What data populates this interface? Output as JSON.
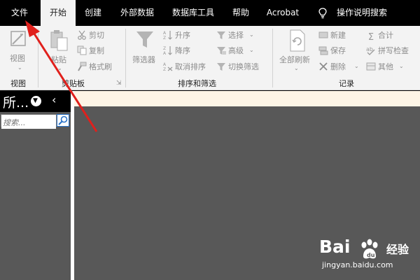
{
  "tabs": [
    {
      "label": "文件"
    },
    {
      "label": "开始"
    },
    {
      "label": "创建"
    },
    {
      "label": "外部数据"
    },
    {
      "label": "数据库工具"
    },
    {
      "label": "帮助"
    },
    {
      "label": "Acrobat"
    },
    {
      "label": "操作说明搜索"
    }
  ],
  "ribbon": {
    "views": {
      "button": "视图",
      "group": "视图"
    },
    "clipboard": {
      "paste": "粘贴",
      "cut": "剪切",
      "copy": "复制",
      "format_painter": "格式刷",
      "group": "剪贴板"
    },
    "sort_filter": {
      "filter": "筛选器",
      "ascending": "升序",
      "descending": "降序",
      "remove_sort": "取消排序",
      "selection": "选择",
      "advanced": "高级",
      "toggle_filter": "切换筛选",
      "group": "排序和筛选"
    },
    "records": {
      "refresh_all": "全部刷新",
      "new": "新建",
      "save": "保存",
      "delete": "删除",
      "totals": "合计",
      "spelling": "拼写检查",
      "more": "其他",
      "group": "记录"
    }
  },
  "nav_pane": {
    "title": "所...",
    "search_placeholder": "搜索..."
  },
  "watermark": {
    "brand_left": "Bai",
    "brand_right": "经验",
    "url": "jingyan.baidu.com"
  },
  "colors": {
    "annotation_arrow": "#e0201c",
    "canvas": "#585858",
    "ribbon": "#f3f3f3"
  }
}
